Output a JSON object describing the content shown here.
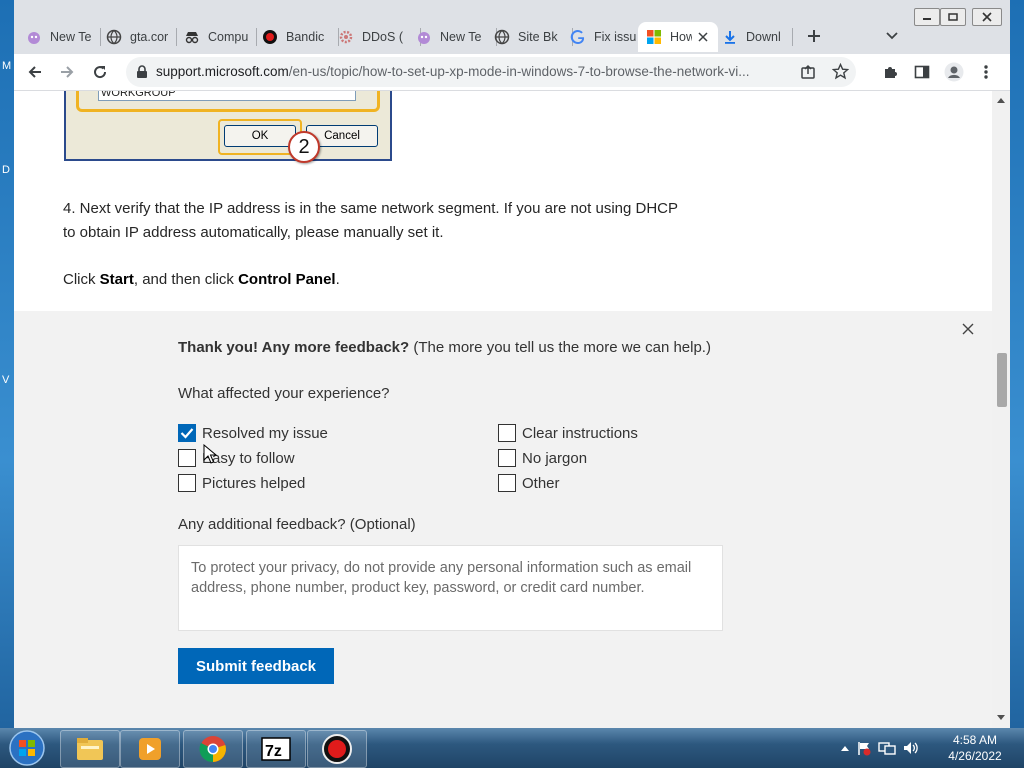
{
  "desktop": {
    "side_letters": [
      "M",
      "D",
      "V"
    ]
  },
  "browser": {
    "tabs": [
      {
        "title": "New Te",
        "icon": "devil-face-icon"
      },
      {
        "title": "gta.cor",
        "icon": "globe-icon"
      },
      {
        "title": "Compu",
        "icon": "spy-icon"
      },
      {
        "title": "Bandic",
        "icon": "record-icon"
      },
      {
        "title": "DDoS (",
        "icon": "gear-icon"
      },
      {
        "title": "New Te",
        "icon": "devil-face-icon"
      },
      {
        "title": "Site Bk",
        "icon": "globe-icon"
      },
      {
        "title": "Fix issu",
        "icon": "google-icon"
      },
      {
        "title": "How",
        "icon": "microsoft-icon"
      },
      {
        "title": "Downl",
        "icon": "download-icon"
      }
    ],
    "url_host": "support.microsoft.com",
    "url_path": "/en-us/topic/how-to-set-up-xp-mode-in-windows-7-to-browse-the-network-vi..."
  },
  "dialog": {
    "field_value": "WORKGROUP",
    "ok_label": "OK",
    "cancel_label": "Cancel",
    "step_number": "2"
  },
  "article": {
    "step4_line1": "4. Next verify that the IP address is in the same network segment. If you are not using DHCP",
    "step4_line2": "to obtain IP address automatically, please manually set it.",
    "click_prefix": "Click ",
    "start_word": "Start",
    "click_middle": ", and then click ",
    "control_panel": "Control Panel",
    "click_suffix": "."
  },
  "feedback": {
    "thanks_bold": "Thank you! Any more feedback?",
    "thanks_rest": " (The more you tell us the more we can help.)",
    "question": "What affected your experience?",
    "options": [
      {
        "label": "Resolved my issue",
        "checked": true
      },
      {
        "label": "Clear instructions",
        "checked": false
      },
      {
        "label": "Easy to follow",
        "checked": false
      },
      {
        "label": "No jargon",
        "checked": false
      },
      {
        "label": "Pictures helped",
        "checked": false
      },
      {
        "label": "Other",
        "checked": false
      }
    ],
    "additional_label": "Any additional feedback? (Optional)",
    "textarea_placeholder": "To protect your privacy, do not provide any personal information such as email address, phone number, product key, password, or credit card number.",
    "submit_label": "Submit feedback"
  },
  "taskbar": {
    "apps": [
      "windows-explorer",
      "media-player",
      "chrome",
      "7-zip",
      "bandicam"
    ],
    "time": "4:58 AM",
    "date": "4/26/2022"
  },
  "colors": {
    "accent": "#0067b8",
    "tabstrip": "#dee1e6",
    "taskbar": "#2d587f"
  }
}
